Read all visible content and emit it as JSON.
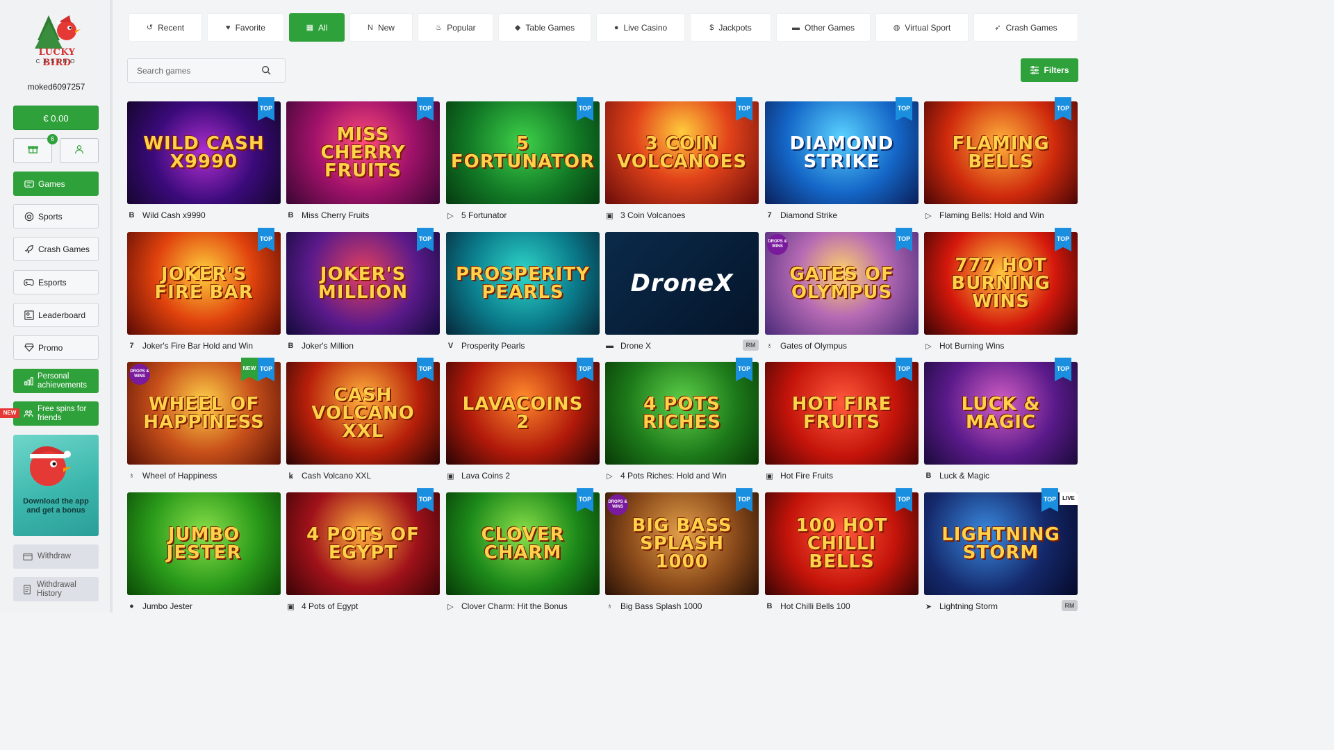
{
  "brand": {
    "logo_line1": "LUCKY BIRD",
    "logo_line2": "CASINO"
  },
  "user": {
    "username": "moked6097257",
    "balance": "€ 0.00",
    "gift_count": "6"
  },
  "sidebar": {
    "items": [
      {
        "label": "Games",
        "icon": "games-icon"
      },
      {
        "label": "Sports",
        "icon": "ball-icon"
      },
      {
        "label": "Crash Games",
        "icon": "rocket-icon"
      },
      {
        "label": "Esports",
        "icon": "gamepad-icon"
      },
      {
        "label": "Leaderboard",
        "icon": "leaderboard-icon"
      },
      {
        "label": "Promo",
        "icon": "diamond-icon"
      },
      {
        "label": "Personal achievements",
        "icon": "chart-icon"
      },
      {
        "label": "Free spins for friends",
        "icon": "friends-icon"
      }
    ],
    "new_tag": "NEW",
    "promo_text": "Download the app and get a bonus",
    "withdraw": "Withdraw",
    "withdraw_history": "Withdrawal History"
  },
  "tabs": [
    {
      "label": "Recent",
      "icon": "history-icon"
    },
    {
      "label": "Favorite",
      "icon": "heart-icon"
    },
    {
      "label": "All",
      "icon": "grid-icon"
    },
    {
      "label": "New",
      "icon": "new-icon"
    },
    {
      "label": "Popular",
      "icon": "fire-icon"
    },
    {
      "label": "Table Games",
      "icon": "diamond-icon"
    },
    {
      "label": "Live Casino",
      "icon": "dealer-icon"
    },
    {
      "label": "Jackpots",
      "icon": "coin-icon"
    },
    {
      "label": "Other Games",
      "icon": "controller-icon"
    },
    {
      "label": "Virtual Sport",
      "icon": "volleyball-icon"
    },
    {
      "label": "Crash Games",
      "icon": "rocket-icon"
    }
  ],
  "search": {
    "placeholder": "Search games"
  },
  "filters_label": "Filters",
  "tag_labels": {
    "top": "TOP",
    "new": "NEW",
    "live": "LIVE",
    "rm": "RM",
    "drops": "DROPS & WINS"
  },
  "games": [
    {
      "name": "Wild Cash x9990",
      "art": "WILD CASH X9990",
      "provider": "B",
      "top": true
    },
    {
      "name": "Miss Cherry Fruits",
      "art": "MISS CHERRY FRUITS",
      "provider": "B",
      "top": true
    },
    {
      "name": "5 Fortunator",
      "art": "5 FORTUNATOR",
      "provider": "▷",
      "top": true
    },
    {
      "name": "3 Coin Volcanoes",
      "art": "3 COIN VOLCANOES",
      "provider": "▣",
      "top": true
    },
    {
      "name": "Diamond Strike",
      "art": "DIAMOND STRIKE",
      "provider": "7",
      "top": true
    },
    {
      "name": "Flaming Bells: Hold and Win",
      "art": "FLAMING BELLS",
      "provider": "▷",
      "top": true
    },
    {
      "name": "Joker's Fire Bar Hold and Win",
      "art": "JOKER'S FIRE BAR",
      "provider": "7",
      "top": true
    },
    {
      "name": "Joker's Million",
      "art": "JOKER'S MILLION",
      "provider": "B",
      "top": true
    },
    {
      "name": "Prosperity Pearls",
      "art": "PROSPERITY PEARLS",
      "provider": "V",
      "top": false
    },
    {
      "name": "Drone X",
      "art": "DroneX",
      "provider": "▬",
      "top": false,
      "rm": true
    },
    {
      "name": "Gates of Olympus",
      "art": "GATES OF OLYMPUS",
      "provider": "♁",
      "top": true,
      "drops": true
    },
    {
      "name": "Hot Burning Wins",
      "art": "777 HOT BURNING WINS",
      "provider": "▷",
      "top": true
    },
    {
      "name": "Wheel of Happiness",
      "art": "WHEEL OF HAPPINESS",
      "provider": "♁",
      "top": true,
      "new": true,
      "drops": true
    },
    {
      "name": "Cash Volcano XXL",
      "art": "CASH VOLCANO XXL",
      "provider": "ꝃ",
      "top": true
    },
    {
      "name": "Lava Coins 2",
      "art": "LAVACOINS 2",
      "provider": "▣",
      "top": true
    },
    {
      "name": "4 Pots Riches: Hold and Win",
      "art": "4 POTS RICHES",
      "provider": "▷",
      "top": true
    },
    {
      "name": "Hot Fire Fruits",
      "art": "HOT FIRE FRUITS",
      "provider": "▣",
      "top": true
    },
    {
      "name": "Luck & Magic",
      "art": "LUCK & MAGIC",
      "provider": "B",
      "top": true
    },
    {
      "name": "Jumbo Jester",
      "art": "JUMBO JESTER",
      "provider": "●",
      "top": false
    },
    {
      "name": "4 Pots of Egypt",
      "art": "4 POTS OF EGYPT",
      "provider": "▣",
      "top": true
    },
    {
      "name": "Clover Charm: Hit the Bonus",
      "art": "CLOVER CHARM",
      "provider": "▷",
      "top": true
    },
    {
      "name": "Big Bass Splash 1000",
      "art": "BIG BASS SPLASH 1000",
      "provider": "♁",
      "top": true,
      "drops": true
    },
    {
      "name": "Hot Chilli Bells 100",
      "art": "100 HOT CHILLI BELLS",
      "provider": "B",
      "top": true
    },
    {
      "name": "Lightning Storm",
      "art": "LIGHTNING STORM",
      "provider": "➤",
      "top": true,
      "live": true,
      "rm": true
    }
  ]
}
